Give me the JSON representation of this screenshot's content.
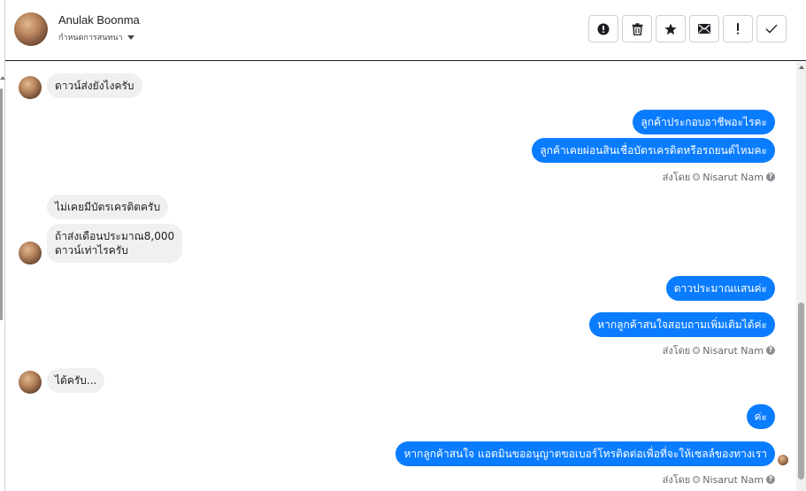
{
  "header": {
    "contact_name": "Anulak Boonma",
    "assign_label": "กำหนดการสนทนา"
  },
  "toolbar": {
    "buttons": [
      {
        "name": "spam-button",
        "icon": "alert-circle-icon"
      },
      {
        "name": "delete-button",
        "icon": "trash-icon"
      },
      {
        "name": "star-button",
        "icon": "star-icon"
      },
      {
        "name": "mark-unread-button",
        "icon": "envelope-icon"
      },
      {
        "name": "follow-up-button",
        "icon": "exclamation-icon"
      },
      {
        "name": "mark-done-button",
        "icon": "check-icon"
      }
    ]
  },
  "messages": [
    {
      "direction": "in",
      "text": "ดาวน์ส่งยังไงครับ"
    },
    {
      "direction": "out",
      "text": "ลูกค้าประกอบอาชีพอะไรคะ"
    },
    {
      "direction": "out",
      "text": "ลูกค้าเคยผ่อนสินเชื่อบัตรเครดิตหรือรถยนต์ไหมคะ"
    },
    {
      "direction": "in",
      "text": "ไม่เคยมีบัตรเครดิตครับ"
    },
    {
      "direction": "in",
      "line1": "ถ้าส่งเดือนประมาณ8,000",
      "line2": "ดาวน์เท่าไรครับ"
    },
    {
      "direction": "out",
      "text": "ดาวประมาณแสนค่ะ"
    },
    {
      "direction": "out",
      "text": "หากลูกค้าสนใจสอบถามเพิ่มเติมได้ค่ะ"
    },
    {
      "direction": "in",
      "text": "ได้ครับ..."
    },
    {
      "direction": "out",
      "text": "ค่ะ"
    },
    {
      "direction": "out",
      "text": "หากลูกค้าสนใจ แอดมินขออนุญาตขอเบอร์โทรติดต่อเพื่อที่จะให้เซลล์ของทางเรา"
    }
  ],
  "sent_by": {
    "prefix": "ส่งโดย",
    "agent": "Nisarut Nam"
  },
  "colors": {
    "outgoing_bubble": "#0a7cff",
    "incoming_bubble": "#f0f0f0"
  }
}
